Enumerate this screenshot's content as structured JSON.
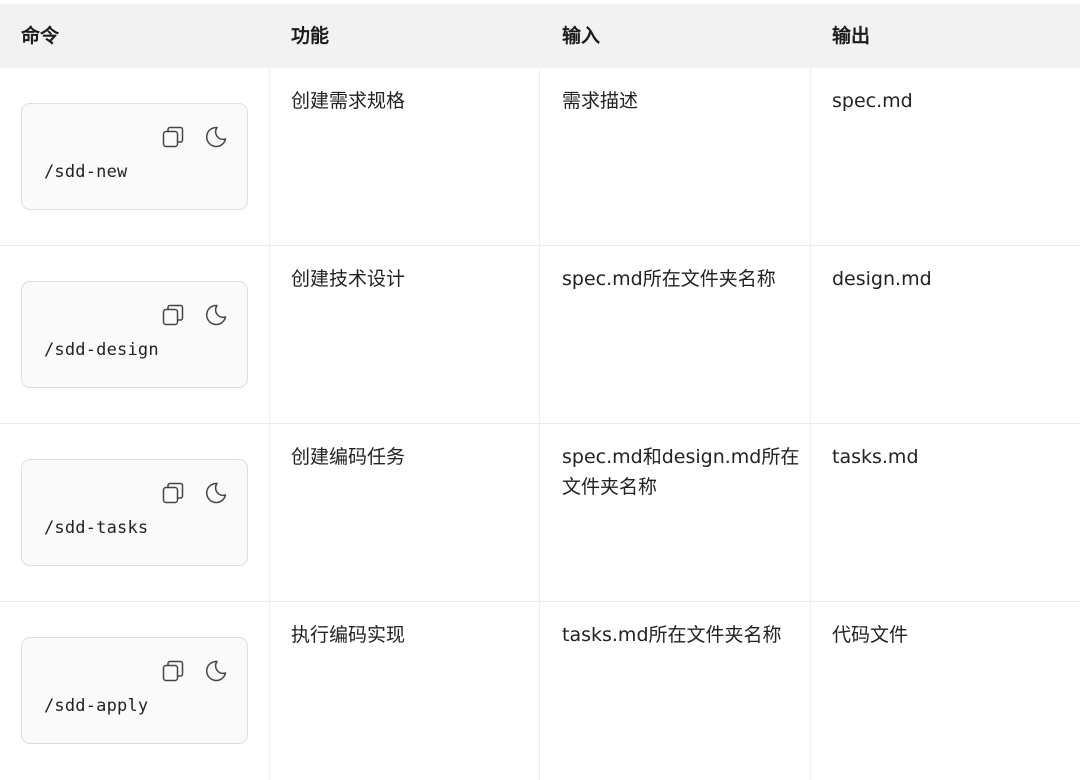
{
  "headers": [
    "命令",
    "功能",
    "输入",
    "输出"
  ],
  "rows": [
    {
      "command": "/sdd-new",
      "function": "创建需求规格",
      "input": "需求描述",
      "output": "spec.md"
    },
    {
      "command": "/sdd-design",
      "function": "创建技术设计",
      "input": "spec.md所在文件夹名称",
      "output": "design.md"
    },
    {
      "command": "/sdd-tasks",
      "function": "创建编码任务",
      "input": "spec.md和design.md所在\n文件夹名称",
      "output": "tasks.md"
    },
    {
      "command": "/sdd-apply",
      "function": "执行编码实现",
      "input": "tasks.md所在文件夹名称",
      "output": "代码文件"
    }
  ],
  "icons": {
    "copy": "copy-icon",
    "theme": "moon-icon"
  }
}
